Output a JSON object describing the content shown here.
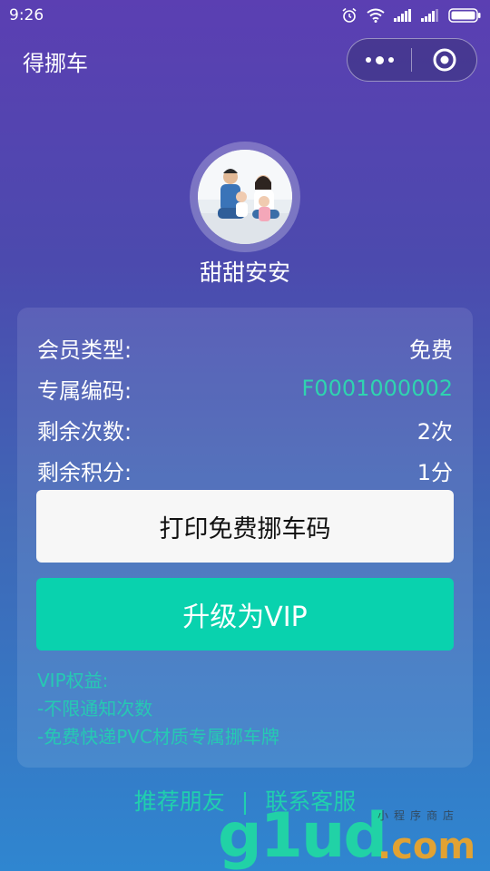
{
  "status_bar": {
    "time": "9:26",
    "icons": [
      "alarm-icon",
      "wifi-icon",
      "signal-icon",
      "signal-icon-2",
      "battery-icon"
    ]
  },
  "nav": {
    "title": "得挪车",
    "more_icon": "more-dots-icon",
    "close_icon": "target-circle-icon"
  },
  "profile": {
    "name": "甜甜安安"
  },
  "info": [
    {
      "label": "会员类型:",
      "value": "免费"
    },
    {
      "label": "专属编码:",
      "value": "F0001000002"
    },
    {
      "label": "剩余次数:",
      "value": "2次"
    },
    {
      "label": "剩余积分:",
      "value": "1分"
    }
  ],
  "buttons": {
    "print": "打印免费挪车码",
    "upgrade": "升级为VIP"
  },
  "benefits": {
    "title": "VIP权益:",
    "items": [
      "-不限通知次数",
      "-免费快递PVC材质专属挪车牌"
    ]
  },
  "footer": {
    "recommend": "推荐朋友",
    "separator": "|",
    "contact": "联系客服"
  },
  "watermark": {
    "main": "g1ud",
    "suffix": ".com",
    "sub": "小程序商店"
  },
  "colors": {
    "accent": "#09d2ae",
    "code_color": "#2fd3b0",
    "benefit_color": "#26c9b3"
  }
}
